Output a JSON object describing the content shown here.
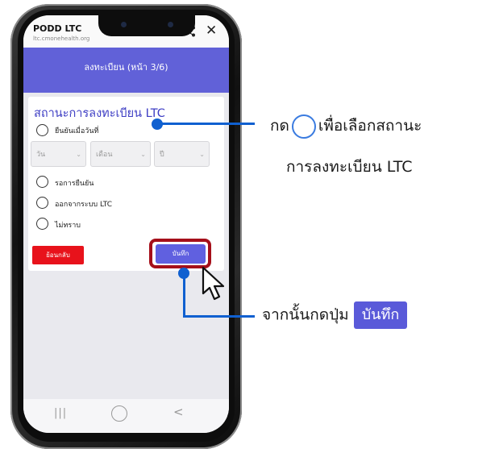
{
  "browser": {
    "title": "PODD LTC",
    "url": "ltc.cmonehealth.org"
  },
  "header": {
    "title": "ลงทะเบียน (หน้า 3/6)"
  },
  "form": {
    "section_title": "สถานะการลงทะเบียน LTC",
    "options": [
      {
        "label": "ยืนยันเมื่อวันที่"
      },
      {
        "label": "รอการยืนยัน"
      },
      {
        "label": "ออกจากระบบ LTC"
      },
      {
        "label": "ไม่ทราบ"
      }
    ],
    "date_selects": {
      "day": "วัน",
      "month": "เดือน",
      "year": "ปี"
    },
    "back_button": "ย้อนกลับ",
    "save_button": "บันทึก"
  },
  "annotations": {
    "instruction1_prefix": "กด",
    "instruction1_suffix": "เพื่อเลือกสถานะ",
    "instruction1_line2": "การลงทะเบียน LTC",
    "instruction2_prefix": "จากนั้นกดปุ่ม",
    "instruction2_button": "บันทึก",
    "accent_color": "#1060d0",
    "highlight_color": "#a50f1a"
  }
}
